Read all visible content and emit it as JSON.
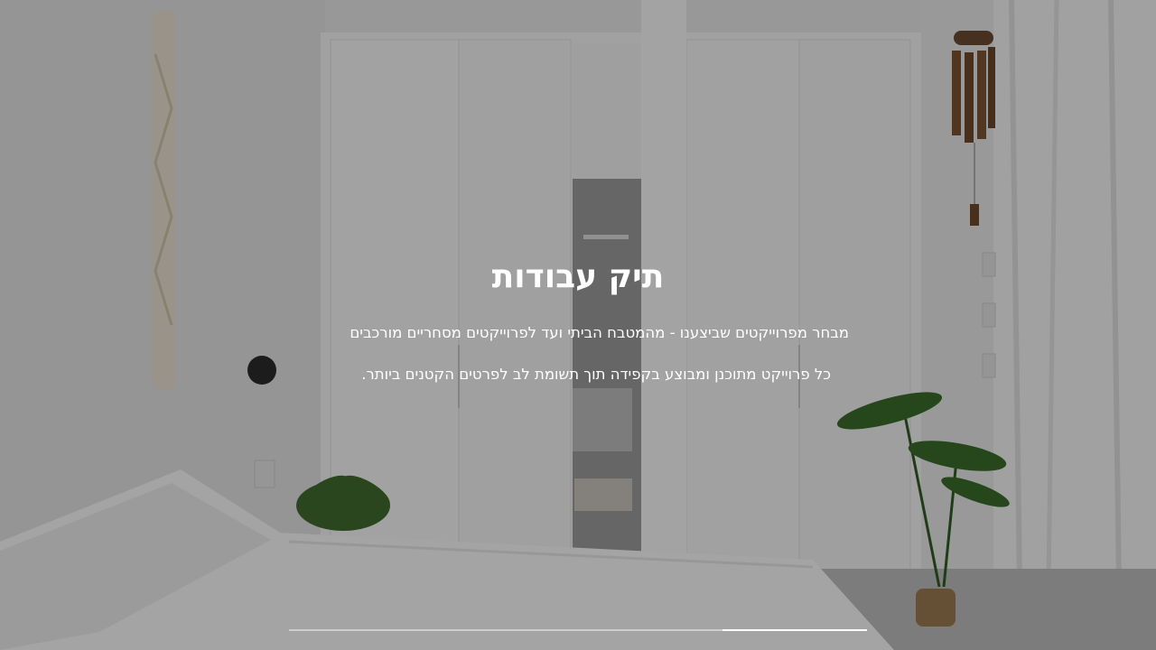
{
  "hero": {
    "title": "תיק עבודות",
    "subtitle_line1": "מבחר מפרוייקטים שביצענו - מהמטבח הביתי ועד לפרוייקטים מסחריים מורכבים",
    "subtitle_line2": "כל פרוייקט מתוכנן ומבוצע בקפידה תוך תשומת לב לפרטים הקטנים ביותר.",
    "image_subject": "white bedroom interior with wardrobe doors, open bathroom doorway, plants and macrame wall hanging"
  },
  "slider": {
    "progress_fraction": 0.25,
    "fill_color": "#ffffff",
    "track_color": "rgba(255,255,255,0.45)"
  }
}
